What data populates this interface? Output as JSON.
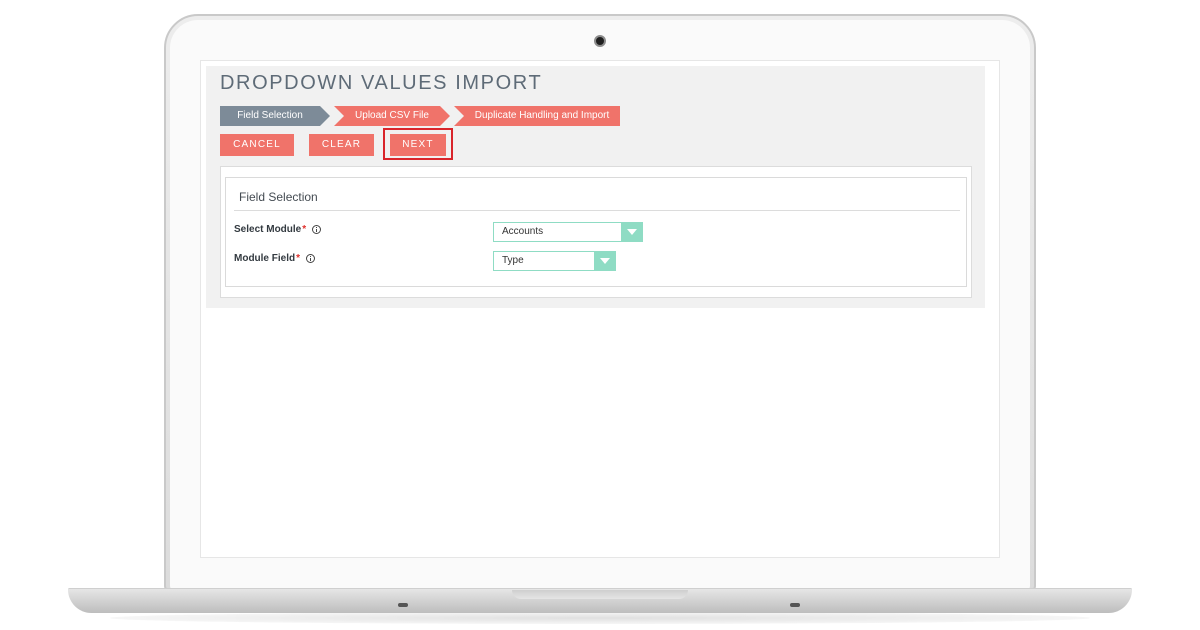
{
  "page": {
    "title": "DROPDOWN VALUES IMPORT"
  },
  "wizard": {
    "steps": [
      {
        "label": "Field Selection",
        "state": "active"
      },
      {
        "label": "Upload CSV File",
        "state": "pending"
      },
      {
        "label": "Duplicate Handling and Import",
        "state": "pending"
      }
    ]
  },
  "toolbar": {
    "cancel_label": "CANCEL",
    "clear_label": "CLEAR",
    "next_label": "NEXT"
  },
  "panel": {
    "header": "Field Selection",
    "fields": [
      {
        "label": "Select Module",
        "required_mark": "*",
        "value": "Accounts"
      },
      {
        "label": "Module Field",
        "required_mark": "*",
        "value": "Type"
      }
    ]
  },
  "colors": {
    "accent": "#f0736a",
    "active_step": "#7d8b98",
    "select_border": "#8fdcc4",
    "highlight": "#d9252b"
  },
  "icons": {
    "info": "info-icon",
    "dropdown": "chevron-down-icon"
  }
}
